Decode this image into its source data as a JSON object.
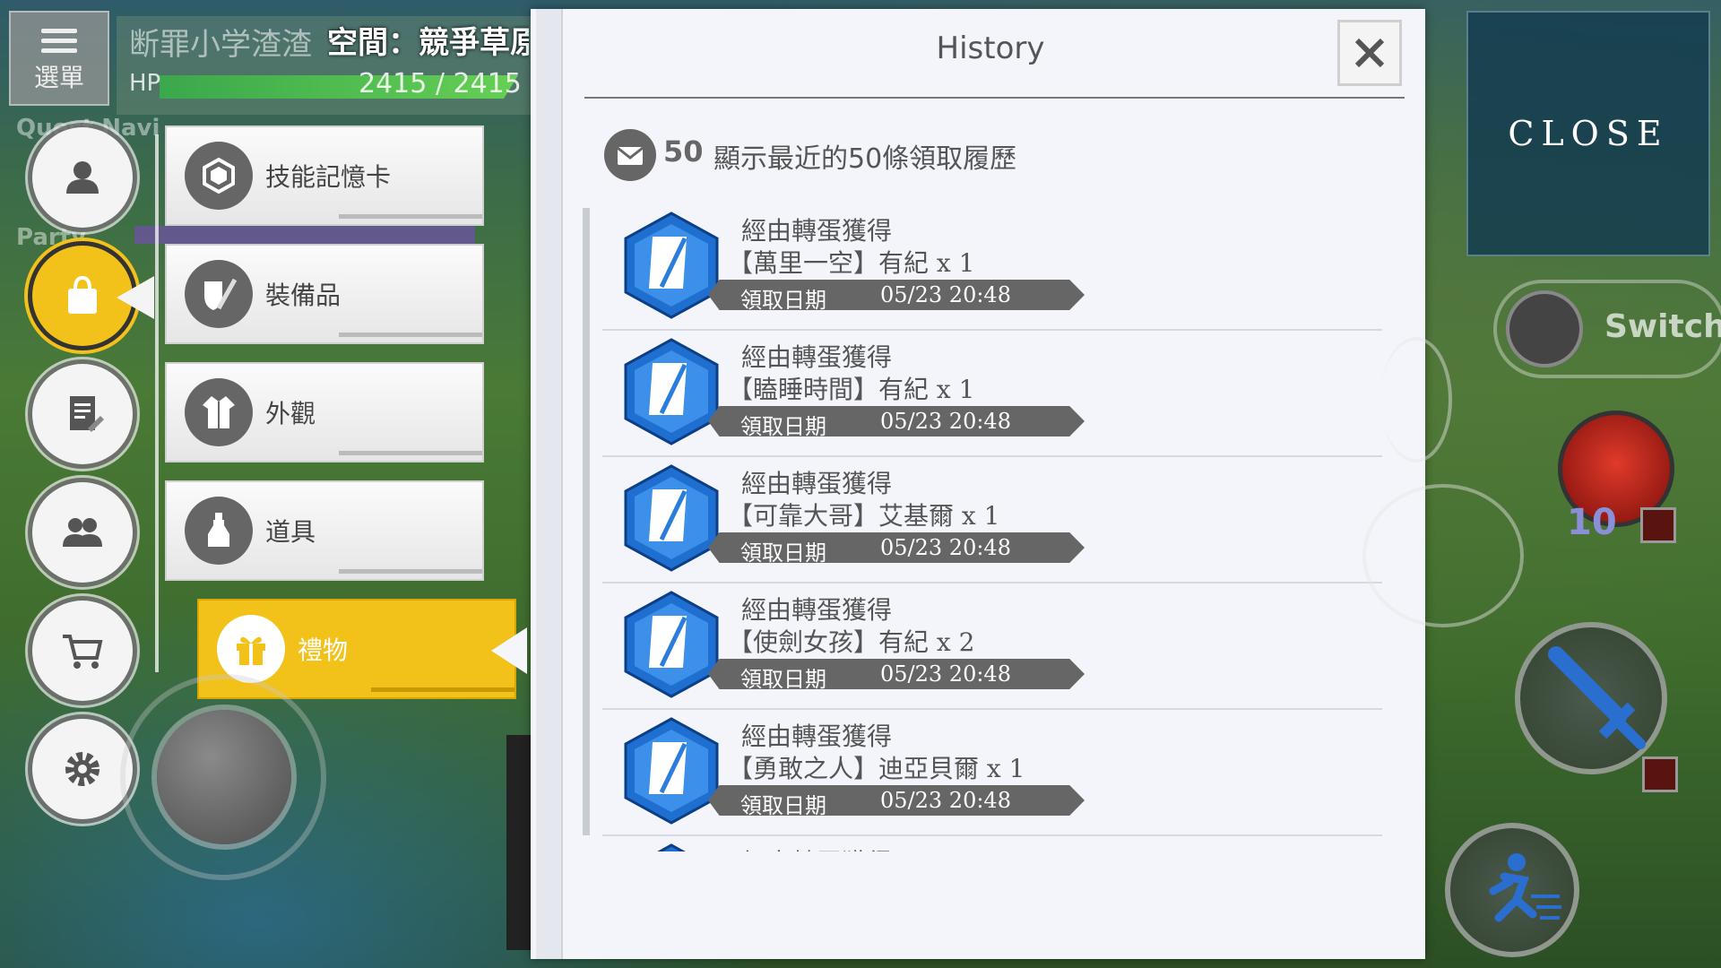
{
  "hud": {
    "menu_label": "選單",
    "player_name": "断罪小学渣渣",
    "area_name": "空間：競爭草原",
    "hp_label": "HP",
    "hp_value": "2415 / 2415",
    "quest_label": "Quest Navi",
    "party_label": "Party"
  },
  "nav": {
    "items": [
      {
        "icon": "profile-icon"
      },
      {
        "icon": "bag-icon"
      },
      {
        "icon": "quest-log-icon"
      },
      {
        "icon": "friends-icon"
      },
      {
        "icon": "shop-cart-icon"
      },
      {
        "icon": "settings-gear-icon"
      }
    ],
    "active_index": 1
  },
  "submenu": {
    "items": [
      {
        "label": "技能記憶卡",
        "icon": "memory-card-icon"
      },
      {
        "label": "裝備品",
        "icon": "equipment-icon"
      },
      {
        "label": "外觀",
        "icon": "appearance-icon"
      },
      {
        "label": "道具",
        "icon": "item-potion-icon"
      },
      {
        "label": "禮物",
        "icon": "gift-icon"
      }
    ],
    "active": "禮物"
  },
  "history": {
    "title": "History",
    "count": "50",
    "description": "顯示最近的50條領取履歷",
    "date_label": "領取日期",
    "entries": [
      {
        "source": "經由轉蛋獲得",
        "item": "【萬里一空】有紀 x 1",
        "date": "05/23 20:48"
      },
      {
        "source": "經由轉蛋獲得",
        "item": "【瞌睡時間】有紀 x 1",
        "date": "05/23 20:48"
      },
      {
        "source": "經由轉蛋獲得",
        "item": "【可靠大哥】艾基爾 x 1",
        "date": "05/23 20:48"
      },
      {
        "source": "經由轉蛋獲得",
        "item": "【使劍女孩】有紀 x 2",
        "date": "05/23 20:48"
      },
      {
        "source": "經由轉蛋獲得",
        "item": "【勇敢之人】迪亞貝爾 x 1",
        "date": "05/23 20:48"
      },
      {
        "source": "經由轉蛋獲得",
        "item": "",
        "date": ""
      }
    ]
  },
  "right_hud": {
    "close_label": "CLOSE",
    "switch_label": "Switch",
    "skill_count": "10"
  },
  "colors": {
    "accent_yellow": "#f2c21a",
    "panel_bg": "#f3f5fa",
    "hex_blue": "#1f6fd1"
  }
}
